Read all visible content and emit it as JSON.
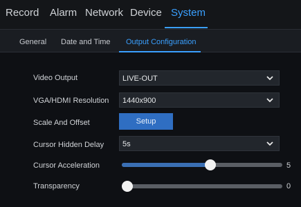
{
  "top_tabs": [
    {
      "label": "Record"
    },
    {
      "label": "Alarm"
    },
    {
      "label": "Network"
    },
    {
      "label": "Device"
    },
    {
      "label": "System"
    }
  ],
  "sub_tabs": [
    {
      "label": "General"
    },
    {
      "label": "Date and Time"
    },
    {
      "label": "Output Configuration"
    }
  ],
  "fields": {
    "video_output": {
      "label": "Video Output",
      "value": "LIVE-OUT"
    },
    "resolution": {
      "label": "VGA/HDMI Resolution",
      "value": "1440x900"
    },
    "scale": {
      "label": "Scale And Offset",
      "button": "Setup"
    },
    "cursor_delay": {
      "label": "Cursor Hidden Delay",
      "value": "5s"
    },
    "cursor_accel": {
      "label": "Cursor Acceleration",
      "value": "5",
      "level_fraction": 0.55
    },
    "transparency": {
      "label": "Transparency",
      "value": "0",
      "level_fraction": 0.0
    }
  },
  "colors": {
    "accent": "#3aa0ff",
    "button": "#2f6ec2",
    "slider_fill": "#3a6fb4"
  },
  "icons": {
    "dropdown": "chevron-down-icon"
  }
}
